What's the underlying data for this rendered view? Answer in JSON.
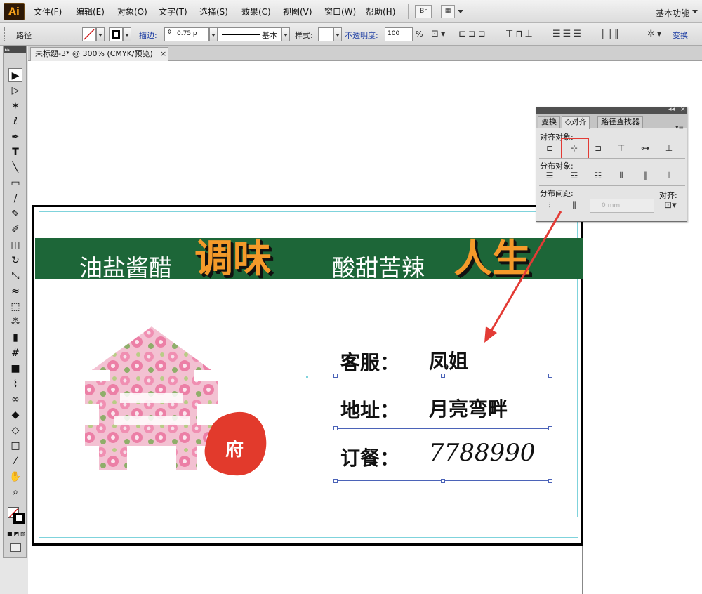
{
  "app": {
    "logo": "Ai"
  },
  "menu": [
    "文件(F)",
    "编辑(E)",
    "对象(O)",
    "文字(T)",
    "选择(S)",
    "效果(C)",
    "视图(V)",
    "窗口(W)",
    "帮助(H)"
  ],
  "menubar_icons": {
    "bridge": "Br",
    "workspace": "基本功能"
  },
  "control_bar": {
    "object_type": "路径",
    "stroke_label": "描边:",
    "stroke_weight": "0.75 p",
    "stroke_style": "基本",
    "style_label": "样式:",
    "opacity_label": "不透明度:",
    "opacity_value": "100",
    "percent": "%",
    "transform_link": "变换"
  },
  "document_tab": {
    "title": "未标题-3* @ 300% (CMYK/预览)",
    "close": "×"
  },
  "toolbox": {
    "tools": [
      {
        "name": "selection-tool",
        "glyph": "▶"
      },
      {
        "name": "direct-selection-tool",
        "glyph": "▷"
      },
      {
        "name": "magic-wand-tool",
        "glyph": "✶"
      },
      {
        "name": "lasso-tool",
        "glyph": "ℓ"
      },
      {
        "name": "pen-tool",
        "glyph": "✒"
      },
      {
        "name": "type-tool",
        "glyph": "T"
      },
      {
        "name": "line-tool",
        "glyph": "╲"
      },
      {
        "name": "rectangle-tool",
        "glyph": "▭"
      },
      {
        "name": "paintbrush-tool",
        "glyph": "∕"
      },
      {
        "name": "pencil-tool",
        "glyph": "✎"
      },
      {
        "name": "blob-brush-tool",
        "glyph": "✐"
      },
      {
        "name": "eraser-tool",
        "glyph": "◫"
      },
      {
        "name": "rotate-tool",
        "glyph": "↻"
      },
      {
        "name": "scale-tool",
        "glyph": "⤡"
      },
      {
        "name": "warp-tool",
        "glyph": "≈"
      },
      {
        "name": "free-transform-tool",
        "glyph": "⬚"
      },
      {
        "name": "symbol-sprayer-tool",
        "glyph": "⁂"
      },
      {
        "name": "column-graph-tool",
        "glyph": "▮"
      },
      {
        "name": "mesh-tool",
        "glyph": "#"
      },
      {
        "name": "gradient-tool",
        "glyph": "■"
      },
      {
        "name": "eyedropper-tool",
        "glyph": "⌇"
      },
      {
        "name": "blend-tool",
        "glyph": "∞"
      },
      {
        "name": "live-paint-tool",
        "glyph": "◆"
      },
      {
        "name": "live-paint-selection-tool",
        "glyph": "◇"
      },
      {
        "name": "artboard-tool",
        "glyph": "□"
      },
      {
        "name": "slice-tool",
        "glyph": "⁄"
      },
      {
        "name": "hand-tool",
        "glyph": "✋"
      },
      {
        "name": "zoom-tool",
        "glyph": "⌕"
      }
    ]
  },
  "artwork": {
    "slogan_left": "油盐酱醋",
    "slogan_big_left": "调味",
    "slogan_right": "酸甜苦辣",
    "slogan_big_right": "人生",
    "logo_badge": "府",
    "contact_label": "客服：",
    "contact_value": "凤姐",
    "address_label": "地址：",
    "address_value": "月亮弯畔",
    "order_label": "订餐：",
    "order_value": "7788990",
    "colors": {
      "banner": "#1d6638",
      "accent_orange": "#f49a2a",
      "badge_red": "#e23a2c",
      "blossom_pink": "#f0a6c0"
    }
  },
  "align_panel": {
    "tabs": [
      "变换",
      "◇对齐",
      "路径查找器"
    ],
    "collapse": "◂◂",
    "close": "×",
    "menu": "▾≡",
    "align_objects_label": "对齐对象:",
    "distribute_objects_label": "分布对象:",
    "distribute_spacing_label": "分布间距:",
    "align_to_label": "对齐:",
    "spacing_value": "0 mm",
    "highlight_color": "#e33b35"
  }
}
